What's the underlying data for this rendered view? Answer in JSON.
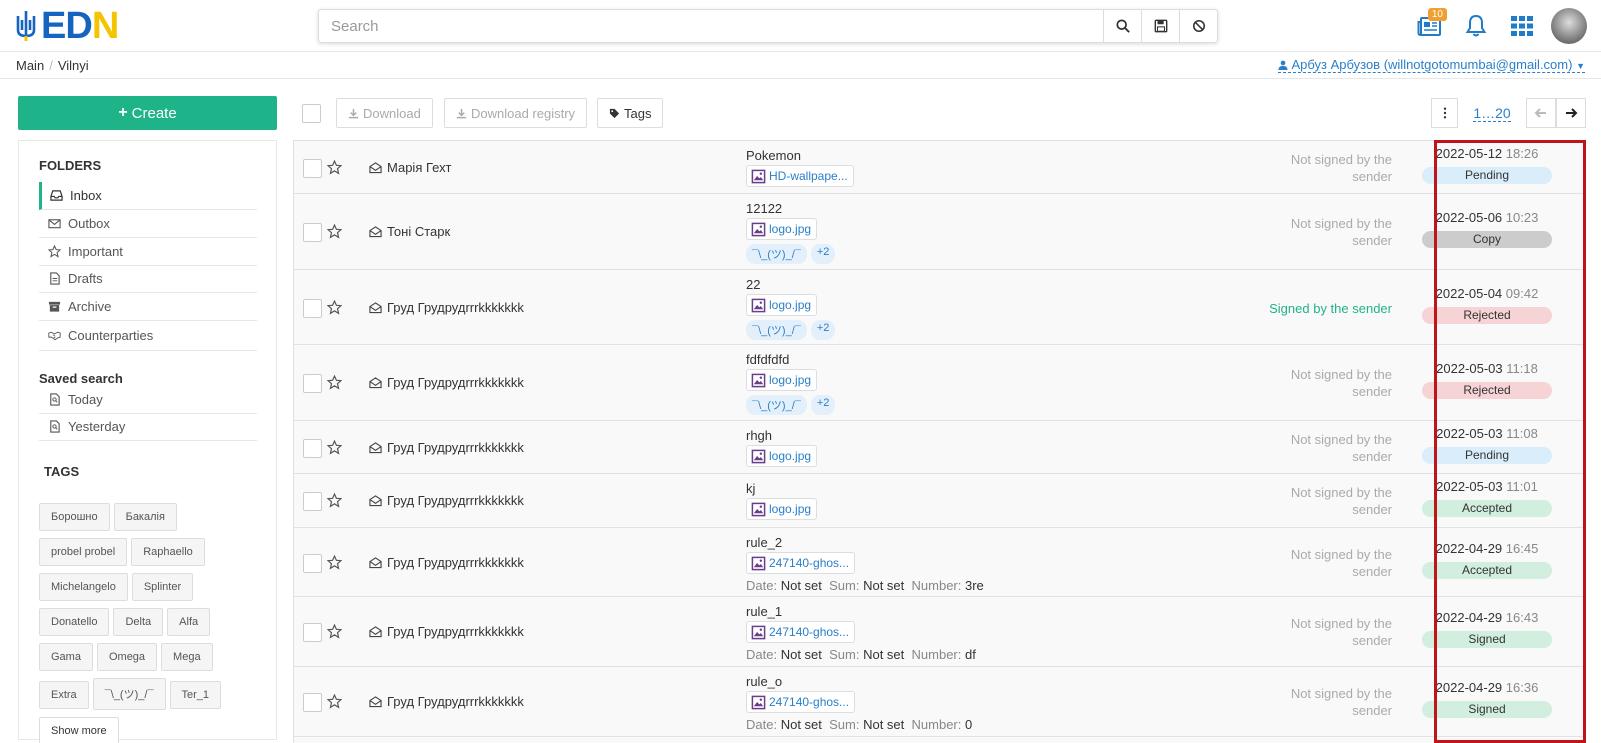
{
  "brand": {
    "logo_text_e": "E",
    "logo_text_d": "D",
    "logo_text_n": "N",
    "colors": {
      "accent": "#1fb38a",
      "link": "#2a7fc8",
      "highlight": "#c0141b"
    }
  },
  "search": {
    "placeholder": "Search"
  },
  "header": {
    "notifications_badge": "10"
  },
  "breadcrumb": {
    "items": [
      "Main",
      "Vilnyi"
    ]
  },
  "user": {
    "label": "Арбуз Арбузов (willnotgotomumbai@gmail.com)"
  },
  "sidebar": {
    "create_label": "Create",
    "folders_title": "FOLDERS",
    "folders": [
      {
        "label": "Inbox",
        "icon": "inbox-icon"
      },
      {
        "label": "Outbox",
        "icon": "envelope-icon"
      },
      {
        "label": "Important",
        "icon": "star-icon"
      },
      {
        "label": "Drafts",
        "icon": "document-icon"
      },
      {
        "label": "Archive",
        "icon": "archive-icon"
      },
      {
        "label": "Counterparties",
        "icon": "handshake-icon"
      }
    ],
    "saved_title": "Saved search",
    "saved": [
      {
        "label": "Today",
        "icon": "saved-search-icon"
      },
      {
        "label": "Yesterday",
        "icon": "saved-search-icon"
      }
    ],
    "tags_title": "TAGS",
    "tags": [
      "Борошно",
      "Бакалія",
      "probel probel",
      "Raphaello",
      "Michelangelo",
      "Splinter",
      "Donatello",
      "Delta",
      "Alfa",
      "Gama",
      "Omega",
      "Mega",
      "Extra",
      "¯\\_(ツ)_/¯",
      "Ter_1"
    ],
    "show_more": "Show more"
  },
  "toolbar": {
    "download": "Download",
    "download_registry": "Download registry",
    "tags": "Tags",
    "page_range": "1…20"
  },
  "documents": [
    {
      "sender": "Марія Гехт",
      "subject": "Pokemon",
      "attachment": "HD-wallpape...",
      "tags": [],
      "more": "",
      "meta": null,
      "signature": "Not signed by the sender",
      "signed": false,
      "date": "2022-05-12",
      "time": "18:26",
      "status": "Pending",
      "status_class": "st-pending"
    },
    {
      "sender": "Тоні Старк",
      "subject": "12122",
      "attachment": "logo.jpg",
      "tags": [
        "¯\\_(ツ)_/¯"
      ],
      "more": "+2",
      "meta": null,
      "signature": "Not signed by the sender",
      "signed": false,
      "date": "2022-05-06",
      "time": "10:23",
      "status": "Copy",
      "status_class": "st-copy"
    },
    {
      "sender": "Груд Грудрудrrrkkkkkkk",
      "subject": "22",
      "attachment": "logo.jpg",
      "tags": [
        "¯\\_(ツ)_/¯"
      ],
      "more": "+2",
      "meta": null,
      "signature": "Signed by the sender",
      "signed": true,
      "date": "2022-05-04",
      "time": "09:42",
      "status": "Rejected",
      "status_class": "st-rejected"
    },
    {
      "sender": "Груд Грудрудrrrkkkkkkk",
      "subject": "fdfdfdfd",
      "attachment": "logo.jpg",
      "tags": [
        "¯\\_(ツ)_/¯"
      ],
      "more": "+2",
      "meta": null,
      "signature": "Not signed by the sender",
      "signed": false,
      "date": "2022-05-03",
      "time": "11:18",
      "status": "Rejected",
      "status_class": "st-rejected"
    },
    {
      "sender": "Груд Грудрудrrrkkkkkkk",
      "subject": "rhgh",
      "attachment": "logo.jpg",
      "tags": [],
      "more": "",
      "meta": null,
      "signature": "Not signed by the sender",
      "signed": false,
      "date": "2022-05-03",
      "time": "11:08",
      "status": "Pending",
      "status_class": "st-pending"
    },
    {
      "sender": "Груд Грудрудrrrkkkkkkk",
      "subject": "kj",
      "attachment": "logo.jpg",
      "tags": [],
      "more": "",
      "meta": null,
      "signature": "Not signed by the sender",
      "signed": false,
      "date": "2022-05-03",
      "time": "11:01",
      "status": "Accepted",
      "status_class": "st-accepted"
    },
    {
      "sender": "Груд Грудрудrrrkkkkkkk",
      "subject": "rule_2",
      "attachment": "247140-ghos...",
      "tags": [],
      "more": "",
      "meta": {
        "date_label": "Date:",
        "date": "Not set",
        "sum_label": "Sum:",
        "sum": "Not set",
        "number_label": "Number:",
        "number": "3re"
      },
      "signature": "Not signed by the sender",
      "signed": false,
      "date": "2022-04-29",
      "time": "16:45",
      "status": "Accepted",
      "status_class": "st-accepted"
    },
    {
      "sender": "Груд Грудрудrrrkkkkkkk",
      "subject": "rule_1",
      "attachment": "247140-ghos...",
      "tags": [],
      "more": "",
      "meta": {
        "date_label": "Date:",
        "date": "Not set",
        "sum_label": "Sum:",
        "sum": "Not set",
        "number_label": "Number:",
        "number": "df"
      },
      "signature": "Not signed by the sender",
      "signed": false,
      "date": "2022-04-29",
      "time": "16:43",
      "status": "Signed",
      "status_class": "st-signed"
    },
    {
      "sender": "Груд Грудрудrrrkkkkkkk",
      "subject": "rule_o",
      "attachment": "247140-ghos...",
      "tags": [],
      "more": "",
      "meta": {
        "date_label": "Date:",
        "date": "Not set",
        "sum_label": "Sum:",
        "sum": "Not set",
        "number_label": "Number:",
        "number": "0"
      },
      "signature": "Not signed by the sender",
      "signed": false,
      "date": "2022-04-29",
      "time": "16:36",
      "status": "Signed",
      "status_class": "st-signed"
    }
  ]
}
